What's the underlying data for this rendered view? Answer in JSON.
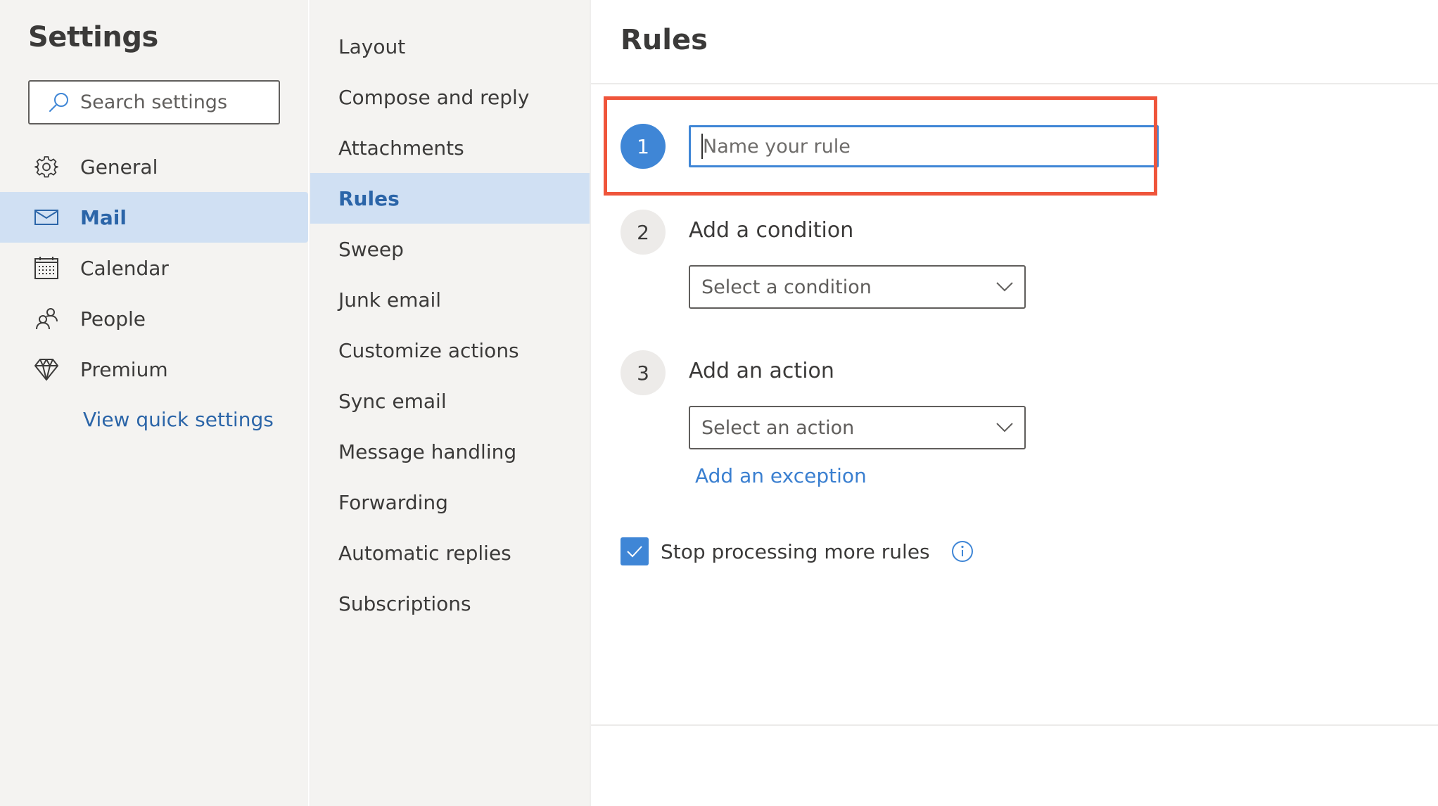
{
  "left_panel": {
    "title": "Settings",
    "search": {
      "placeholder": "Search settings",
      "value": ""
    },
    "nav": [
      {
        "label": "General",
        "icon": "gear-icon",
        "selected": false
      },
      {
        "label": "Mail",
        "icon": "mail-icon",
        "selected": true
      },
      {
        "label": "Calendar",
        "icon": "calendar-icon",
        "selected": false
      },
      {
        "label": "People",
        "icon": "people-icon",
        "selected": false
      },
      {
        "label": "Premium",
        "icon": "diamond-icon",
        "selected": false
      }
    ],
    "quick_settings_link": "View quick settings"
  },
  "mail_menu": {
    "items": [
      {
        "label": "Layout",
        "selected": false
      },
      {
        "label": "Compose and reply",
        "selected": false
      },
      {
        "label": "Attachments",
        "selected": false
      },
      {
        "label": "Rules",
        "selected": true
      },
      {
        "label": "Sweep",
        "selected": false
      },
      {
        "label": "Junk email",
        "selected": false
      },
      {
        "label": "Customize actions",
        "selected": false
      },
      {
        "label": "Sync email",
        "selected": false
      },
      {
        "label": "Message handling",
        "selected": false
      },
      {
        "label": "Forwarding",
        "selected": false
      },
      {
        "label": "Automatic replies",
        "selected": false
      },
      {
        "label": "Subscriptions",
        "selected": false
      }
    ]
  },
  "rules": {
    "title": "Rules",
    "step1": {
      "number": "1",
      "placeholder": "Name your rule",
      "value": ""
    },
    "step2": {
      "number": "2",
      "heading": "Add a condition",
      "dropdown_value": "Select a condition"
    },
    "step3": {
      "number": "3",
      "heading": "Add an action",
      "dropdown_value": "Select an action"
    },
    "exception_link": "Add an exception",
    "stop_processing": {
      "label": "Stop processing more rules",
      "checked": true
    }
  },
  "colors": {
    "accent": "#3f86d6",
    "link": "#2b65a8",
    "selected_bg": "#d0e0f3",
    "highlight_box": "#ef553b",
    "panel_bg": "#f4f3f1"
  }
}
